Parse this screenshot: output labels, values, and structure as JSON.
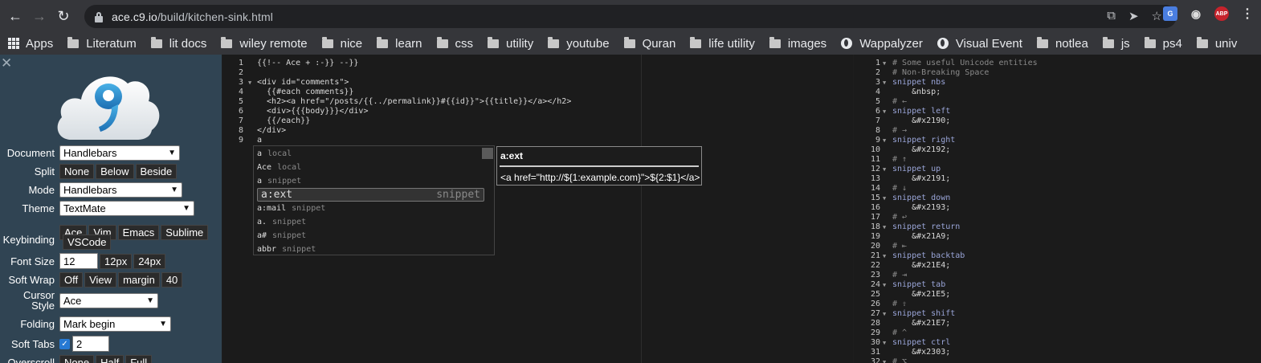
{
  "browser": {
    "url_host": "ace.c9.io",
    "url_path": "/build/kitchen-sink.html",
    "bookmarks": [
      "Apps",
      "Literatum",
      "lit docs",
      "wiley remote",
      "nice",
      "learn",
      "css",
      "utility",
      "youtube",
      "Quran",
      "life utility",
      "images",
      "Wappalyzer",
      "Visual Event",
      "notlea",
      "js",
      "ps4",
      "univ"
    ],
    "bookmark_icons": [
      "apps-icon",
      "folder-icon",
      "folder-icon",
      "folder-icon",
      "folder-icon",
      "folder-icon",
      "folder-icon",
      "folder-icon",
      "folder-icon",
      "folder-icon",
      "folder-icon",
      "folder-icon",
      "globe-icon",
      "globe-icon",
      "folder-icon",
      "folder-icon",
      "folder-icon",
      "folder-icon"
    ],
    "abp_label": "ABP"
  },
  "sidebar": {
    "close_glyph": "✕",
    "document_label": "Document",
    "document_value": "Handlebars",
    "split_label": "Split",
    "split_options": [
      "None",
      "Below",
      "Beside"
    ],
    "mode_label": "Mode",
    "mode_value": "Handlebars",
    "theme_label": "Theme",
    "theme_value": "TextMate",
    "keybinding_label": "Keybinding",
    "keybinding_options": [
      "Ace",
      "Vim",
      "Emacs",
      "Sublime",
      "VSCode"
    ],
    "fontsize_label": "Font Size",
    "fontsize_value": "12",
    "fontsize_options": [
      "12px",
      "24px"
    ],
    "softwrap_label": "Soft Wrap",
    "softwrap_options": [
      "Off",
      "View",
      "margin",
      "40"
    ],
    "cursor_label_1": "Cursor",
    "cursor_label_2": "Style",
    "cursor_value": "Ace",
    "folding_label": "Folding",
    "folding_value": "Mark begin",
    "softtabs_label": "Soft Tabs",
    "softtabs_checked": true,
    "softtabs_value": "2",
    "overscroll_label": "Overscroll",
    "overscroll_options": [
      "None",
      "Half",
      "Full"
    ]
  },
  "editor1": {
    "line_numbers": [
      "1",
      "2",
      "3",
      "4",
      "5",
      "6",
      "7",
      "8",
      "9"
    ],
    "lines": [
      "{{!-- Ace + :-}} --}}",
      "",
      "<div id=\"comments\">",
      "  {{#each comments}}",
      "  <h2><a href=\"/posts/{{../permalink}}#{{id}}\">{{title}}</a></h2>",
      "  <div>{{{body}}}</div>",
      "  {{/each}}",
      "</div>",
      "a"
    ]
  },
  "autocomplete": {
    "items": [
      {
        "caption": "a",
        "meta": "local"
      },
      {
        "caption": "Ace",
        "meta": "local"
      },
      {
        "caption": "a",
        "meta": "snippet"
      },
      {
        "caption": "a:ext",
        "meta": "snippet"
      },
      {
        "caption": "a:mail",
        "meta": "snippet"
      },
      {
        "caption": "a.",
        "meta": "snippet"
      },
      {
        "caption": "a#",
        "meta": "snippet"
      },
      {
        "caption": "abbr",
        "meta": "snippet"
      }
    ],
    "selected_index": 3,
    "doc_title": "a:ext",
    "doc_body": "<a href=\"http://${1:example.com}\">${2:$1}</a>"
  },
  "editor2": {
    "line_numbers": [
      "1",
      "2",
      "3",
      "4",
      "5",
      "6",
      "7",
      "8",
      "9",
      "10",
      "11",
      "12",
      "13",
      "14",
      "15",
      "16",
      "17",
      "18",
      "19",
      "20",
      "21",
      "22",
      "23",
      "24",
      "25",
      "26",
      "27",
      "28",
      "29",
      "30",
      "31",
      "32"
    ],
    "lines": [
      "# Some useful Unicode entities",
      "# Non-Breaking Space",
      "snippet nbs",
      "\t&nbsp;",
      "# ←",
      "snippet left",
      "\t&#x2190;",
      "# →",
      "snippet right",
      "\t&#x2192;",
      "# ↑",
      "snippet up",
      "\t&#x2191;",
      "# ↓",
      "snippet down",
      "\t&#x2193;",
      "# ↩",
      "snippet return",
      "\t&#x21A9;",
      "# ⇤",
      "snippet backtab",
      "\t&#x21E4;",
      "# ⇥",
      "snippet tab",
      "\t&#x21E5;",
      "# ⇧",
      "snippet shift",
      "\t&#x21E7;",
      "# ^",
      "snippet ctrl",
      "\t&#x2303;",
      "# ⌥"
    ]
  }
}
